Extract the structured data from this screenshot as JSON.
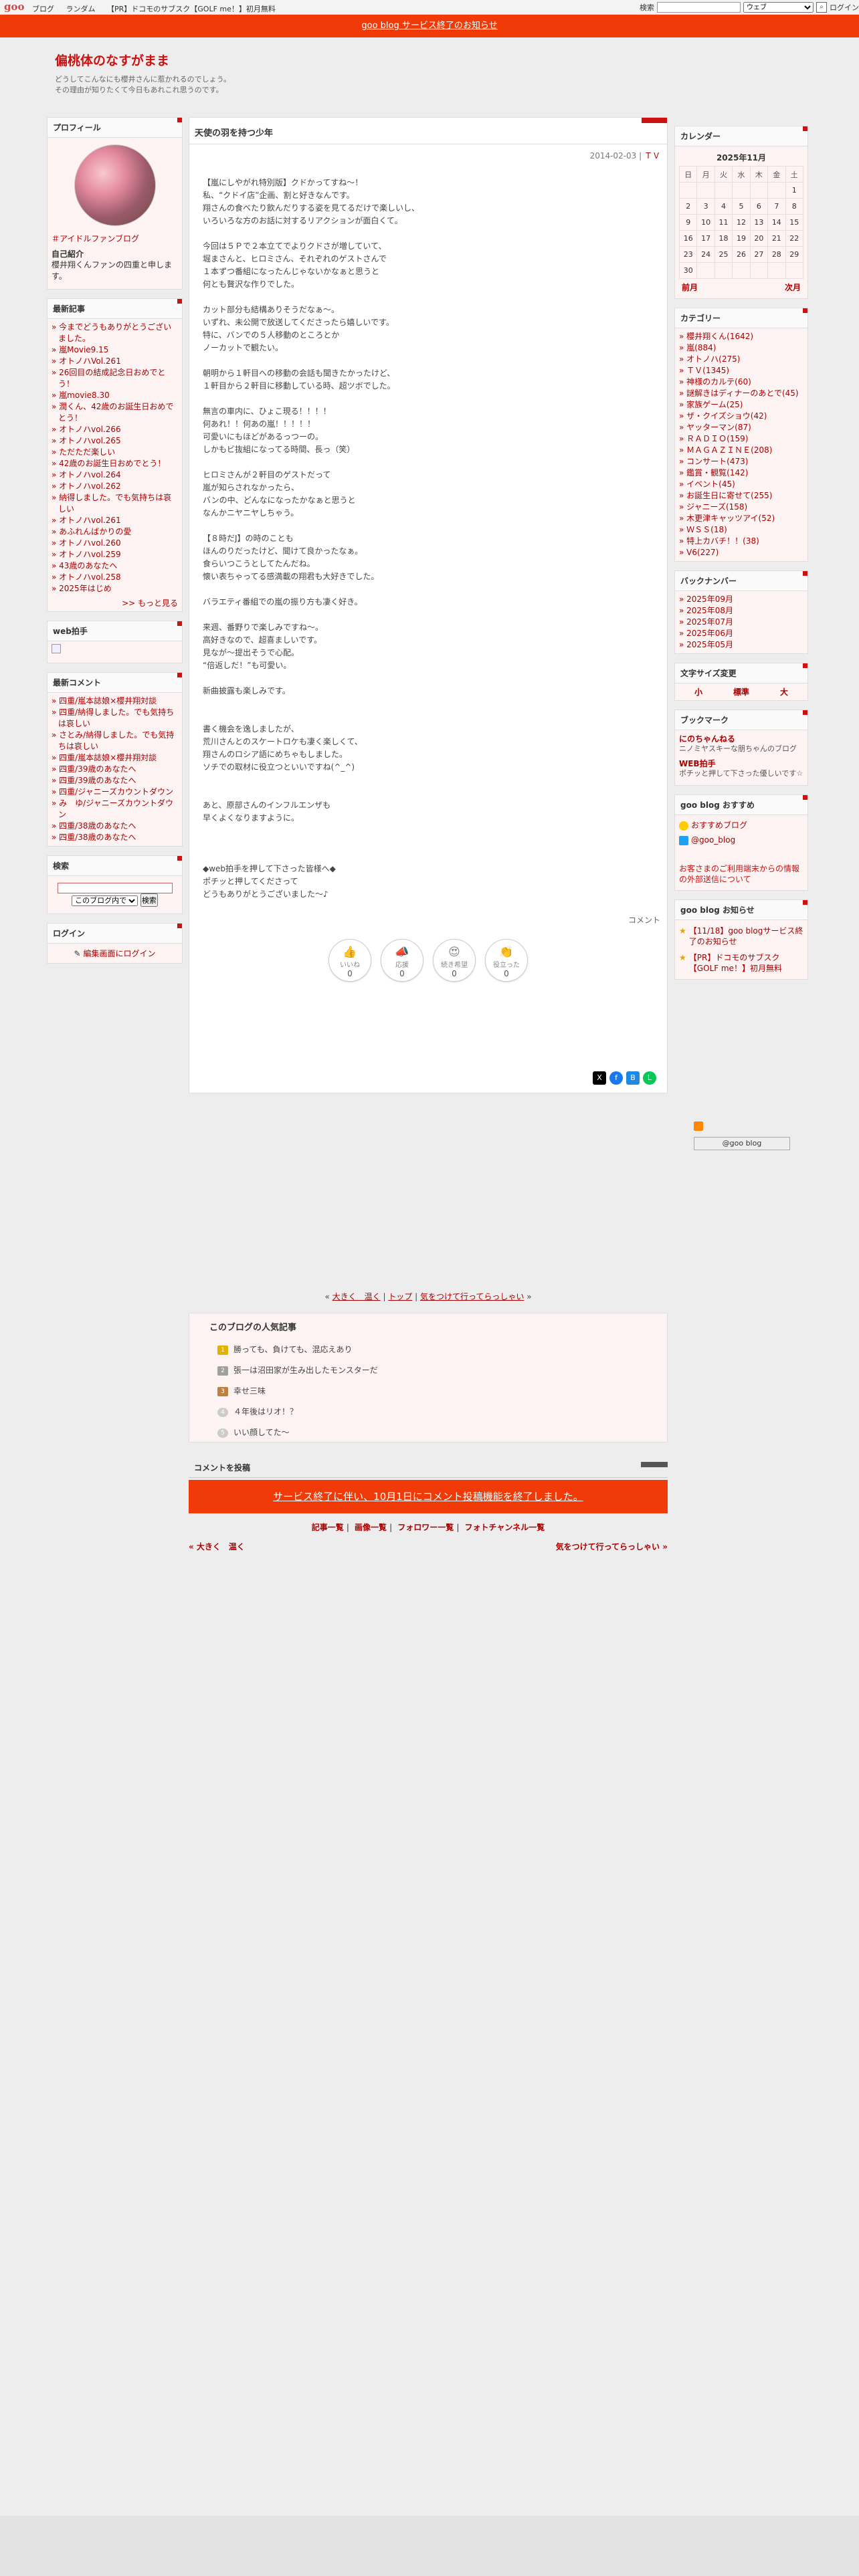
{
  "topbar": {
    "logo": "goo",
    "links": [
      "ブログ",
      "ランダム",
      "【PR】ドコモのサブスク【GOLF me！】初月無料"
    ],
    "search_label": "検索",
    "search_option": "ウェブ",
    "login": "ログイン"
  },
  "notice": "goo blog サービス終了のお知らせ",
  "blog": {
    "title": "偏桃体のなすがまま",
    "desc": "どうしてこんなにも櫻井さんに惹かれるのでしょう。\nその理由が知りたくて今日もあれこれ思うのです。"
  },
  "profile": {
    "heading": "プロフィール",
    "name": "＃アイドルファンブログ",
    "intro_label": "自己紹介",
    "intro": "櫻井翔くんファンの四重と申します。"
  },
  "recent": {
    "heading": "最新記事",
    "items": [
      "今までどうもありがとうございました。",
      "嵐Movie9.15",
      "オトノハVol.261",
      "26回目の結成記念日おめでとう！",
      "嵐movie8.30",
      "潤くん、42歳のお誕生日おめでとう！",
      "オトノハvol.266",
      "オトノハvol.265",
      "ただただ楽しい",
      "42歳のお誕生日おめでとう！",
      "オトノハvol.264",
      "オトノハvol.262",
      "納得しました。でも気持ちは哀しい",
      "オトノハvol.261",
      "あふれんばかりの愛",
      "オトノハvol.260",
      "オトノハvol.259",
      "43歳のあなたへ",
      "オトノハvol.258",
      "2025年はじめ"
    ],
    "more": ">> もっと見る"
  },
  "webclap": {
    "heading": "web拍手"
  },
  "comments": {
    "heading": "最新コメント",
    "items": [
      "四重/嵐本誌娘×櫻井翔対談",
      "四重/納得しました。でも気持ちは哀しい",
      "さとみ/納得しました。でも気持ちは哀しい",
      "四重/嵐本誌娘×櫻井翔対談",
      "四重/39歳のあなたへ",
      "四重/39歳のあなたへ",
      "四重/ジャニーズカウントダウン",
      "み　ゆ/ジャニーズカウントダウン",
      "四重/38歳のあなたへ",
      "四重/38歳のあなたへ"
    ]
  },
  "search": {
    "heading": "検索",
    "scope": "このブログ内で",
    "button": "検索"
  },
  "login": {
    "heading": "ログイン",
    "link": "編集画面にログイン"
  },
  "article": {
    "title": "天使の羽を持つ少年",
    "date": "2014-02-03",
    "category": "ＴＶ",
    "lines": [
      "",
      "【嵐にしやがれ特別版】クドかってすね〜！",
      "私、“クドイ店”企画、割と好きなんです。",
      "翔さんの食べたり飲んだりする姿を見てるだけで楽しいし、",
      "いろいろな方のお話に対するリアクションが面白くて。",
      "",
      "今回は５Ｐで２本立てでよりクドさが増していて、",
      "堀まさんと、ヒロミさん、それぞれのゲストさんで",
      "１本ずつ番組になったんじゃないかなぁと思うと",
      "何とも贅沢な作りでした。",
      "",
      "カット部分も結構ありそうだなぁ〜。",
      "いずれ、未公開で放送してくださったら嬉しいです。",
      "特に、バンでの５人移動のところとか",
      "ノーカットで観たい。",
      "",
      "朝明から１軒目への移動の会話も聞きたかったけど、",
      "１軒目から２軒目に移動している時、超ツボでした。",
      "",
      "無言の車内に、ひょこ現る！！！！",
      "何あれ！！何あの嵐！！！！！",
      "可愛いにもほどがあるっつーの。",
      "しかもビ抜組になってる時間、長っ（笑）",
      "",
      "ヒロミさんが２軒目のゲストだって",
      "嵐が知らされなかったら、",
      "バンの中、どんなになったかなぁと思うと",
      "なんかニヤニヤしちゃう。",
      "",
      "【８時だJ】の時のことも",
      "ほんのりだったけど、聞けて良かったなぁ。",
      "食らいつこうとしてたんだね。",
      "懐い表ちゃってる感満載の翔君も大好きでした。",
      "",
      "バラエティ番組での嵐の振り方も凄く好き。",
      "",
      "来週、番野りで楽しみですね〜。",
      "高好きなので、超喜ましいです。",
      "見なが〜提出そうで心配。",
      "“倍返しだ！”も可愛い。",
      "",
      "新曲披露も楽しみです。",
      "",
      "",
      "書く機会を逸しましたが、",
      "荒川さんとのスケートロケも凄く楽しくて、",
      "翔さんのロシア語にめちゃもしました。",
      "ソチでの取材に役立つといいですね(^_^)",
      "",
      "",
      "あと、原部さんのインフルエンザも",
      "早くよくなりますように。",
      "",
      "",
      "",
      "◆web拍手を押して下さった皆様へ◆",
      "ポチッと押してくださって",
      "どうもありがとうございました〜♪"
    ],
    "comment_link": "コメント",
    "reactions": [
      {
        "label": "いいね",
        "count": "0"
      },
      {
        "label": "応援",
        "count": "0"
      },
      {
        "label": "続き希望",
        "count": "0"
      },
      {
        "label": "役立った",
        "count": "0"
      }
    ]
  },
  "nav": {
    "prev": "大きく　温く",
    "top": "トップ",
    "next": "気をつけて行ってらっしゃい"
  },
  "popular": {
    "heading": "このブログの人気記事",
    "items": [
      "勝っても、負けても、混応えあり",
      "張一は沼田家が生み出したモンスターだ",
      "幸せ三味",
      "４年後はリオ！？",
      "いい顔してた〜"
    ]
  },
  "comment_section": {
    "heading": "コメントを投稿",
    "notice": "サービス終了に伴い、10月1日にコメント投稿機能を終了しました。"
  },
  "footlinks": [
    "記事一覧",
    "画像一覧",
    "フォロワー一覧",
    "フォトチャンネル一覧"
  ],
  "footnav": {
    "prev": "« 大きく　温く",
    "next": "気をつけて行ってらっしゃい »"
  },
  "calendar": {
    "heading": "カレンダー",
    "month": "2025年11月",
    "days": [
      "日",
      "月",
      "火",
      "水",
      "木",
      "金",
      "土"
    ],
    "weeks": [
      [
        "",
        "",
        "",
        "",
        "",
        "",
        "1"
      ],
      [
        "2",
        "3",
        "4",
        "5",
        "6",
        "7",
        "8"
      ],
      [
        "9",
        "10",
        "11",
        "12",
        "13",
        "14",
        "15"
      ],
      [
        "16",
        "17",
        "18",
        "19",
        "20",
        "21",
        "22"
      ],
      [
        "23",
        "24",
        "25",
        "26",
        "27",
        "28",
        "29"
      ],
      [
        "30",
        "",
        "",
        "",
        "",
        "",
        ""
      ]
    ],
    "prev": "前月",
    "next": "次月"
  },
  "categories": {
    "heading": "カテゴリー",
    "items": [
      "櫻井翔くん(1642)",
      "嵐(884)",
      "オトノハ(275)",
      "ＴＶ(1345)",
      "神様のカルテ(60)",
      "謎解きはディナーのあとで(45)",
      "家族ゲーム(25)",
      "ザ・クイズショウ(42)",
      "ヤッターマン(87)",
      "ＲＡＤＩＯ(159)",
      "ＭＡＧＡＺＩＮＥ(208)",
      "コンサート(473)",
      "鑑賞・観覧(142)",
      "イベント(45)",
      "お誕生日に寄せて(255)",
      "ジャニーズ(158)",
      "木更津キャッツアイ(52)",
      "ＷＳＳ(18)",
      "特上カバチ！！(38)",
      "V6(227)"
    ]
  },
  "backnumber": {
    "heading": "バックナンバー",
    "items": [
      "2025年09月",
      "2025年08月",
      "2025年07月",
      "2025年06月",
      "2025年05月"
    ]
  },
  "textsize": {
    "heading": "文字サイズ変更",
    "options": [
      "小",
      "標準",
      "大"
    ]
  },
  "bookmarks": {
    "heading": "ブックマーク",
    "items": [
      {
        "title": "にのちゃんねる",
        "desc": "ニノミヤスキーな朋ちゃんのブログ"
      },
      {
        "title": "WEB拍手",
        "desc": "ポチッと押して下さった優しいです☆"
      }
    ]
  },
  "recommend": {
    "heading": "goo blog おすすめ",
    "items": [
      "おすすめブログ",
      "@goo_blog"
    ],
    "notice": "お客さまのご利用端末からの情報の外部送信について"
  },
  "gooinfo": {
    "heading": "goo blog お知らせ",
    "items": [
      "【11/18】goo blogサービス終了のお知らせ",
      "【PR】ドコモのサブスク【GOLF me！】初月無料"
    ]
  },
  "footer_button": "@goo blog",
  "colors": {
    "accent": "#f03a07",
    "link": "#aa0000",
    "title": "#cc1111"
  }
}
